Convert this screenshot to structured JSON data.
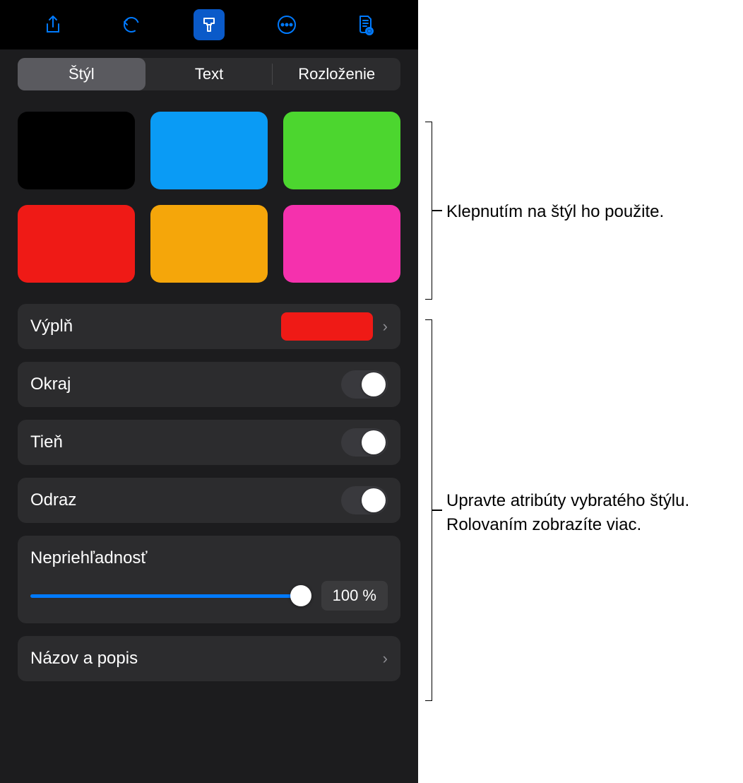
{
  "toolbar": {
    "share": "share",
    "undo": "undo",
    "format": "format",
    "more": "more",
    "document": "document"
  },
  "tabs": {
    "style": "Štýl",
    "text": "Text",
    "layout": "Rozloženie"
  },
  "swatches": {
    "colors": [
      "#000000",
      "#0a9bf5",
      "#4cd62f",
      "#ef1a16",
      "#f5a60a",
      "#f531ad"
    ]
  },
  "rows": {
    "fill": "Výplň",
    "fillColor": "#ef1a16",
    "border": "Okraj",
    "shadow": "Tieň",
    "reflection": "Odraz",
    "opacity": "Nepriehľadnosť",
    "opacityValue": "100 %",
    "titleCaption": "Názov a popis"
  },
  "annotations": {
    "tap": "Klepnutím na štýl ho použite.",
    "adjust": "Upravte atribúty vybratého štýlu. Rolovaním zobrazíte viac."
  }
}
